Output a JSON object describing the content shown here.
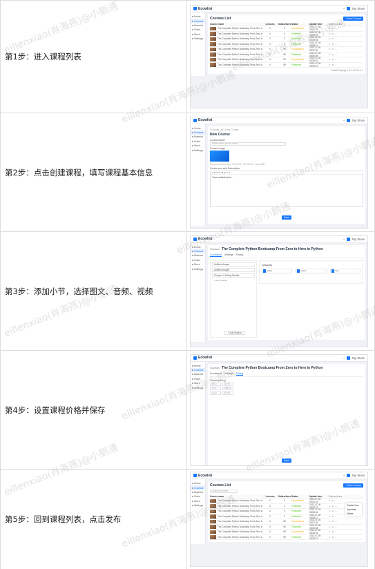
{
  "steps": [
    {
      "label": "第1步：进入课程列表"
    },
    {
      "label": "第2步：点击创建课程，填写课程基本信息"
    },
    {
      "label": "第3步：添加小节，选择图文、音频、视频"
    },
    {
      "label": "第4步：设置课程价格并保存"
    },
    {
      "label": "第5步：回到课程列表，点击发布"
    }
  ],
  "watermark": "eillenxiao(肖海燕)@小鹅通",
  "app": {
    "logo": "Ecowlist",
    "user": "My Store",
    "nav": [
      "Home",
      "Courses",
      "Material",
      "Order",
      "Store",
      "Settings"
    ]
  },
  "course_list": {
    "title": "Courses List",
    "new_button": "+ New Course",
    "search_placeholder": "Search by name",
    "columns": [
      "Course name",
      "Lessons",
      "Subscribers",
      "Status",
      "Update time",
      "Operation"
    ],
    "rows": [
      {
        "name": "The Complete Python Bootcamp From Zero to Hero in Python",
        "lessons": "0",
        "subs": "0",
        "status": "Unpublished",
        "time": "2023-07-05 09:00:23"
      },
      {
        "name": "The Complete Python Bootcamp From Zero to Hero in Python",
        "lessons": "0",
        "subs": "0",
        "status": "Published",
        "time": "2023-07-05 08:59:12"
      },
      {
        "name": "The Complete Python Bootcamp From Zero to Hero in Python",
        "lessons": "0",
        "subs": "0",
        "status": "Published",
        "time": "2023-07-05 08:58:45"
      },
      {
        "name": "The Complete Python Bootcamp From Zero to Hero in Python",
        "lessons": "0",
        "subs": "0",
        "status": "Published",
        "time": "2023-07-05 08:58:11"
      },
      {
        "name": "The Complete Python Bootcamp From Zero to Hero in Python",
        "lessons": "0",
        "subs": "99",
        "status": "Unpublished",
        "time": "2023-07-05 08:57:30"
      },
      {
        "name": "The Complete Python Bootcamp From Zero to Hero in Python",
        "lessons": "0",
        "subs": "99",
        "status": "Published",
        "time": "2023-07-05 08:56:58"
      },
      {
        "name": "The Complete Python Bootcamp From Zero to Hero in Python",
        "lessons": "0",
        "subs": "99",
        "status": "Unpublished",
        "time": "2023-07-05 08:56:02"
      },
      {
        "name": "The Complete Python Bootcamp From Zero to Hero in Python",
        "lessons": "0",
        "subs": "99",
        "status": "Published",
        "time": "2023-07-05 08:55:21"
      }
    ],
    "ops": "✎ ⧉ ⋯",
    "pager": "Total 8   10/page   1   2   3   4   5   Go to 1"
  },
  "new_course": {
    "crumb": "Courses List / New Course",
    "title": "New Course",
    "name_label": "Course Name",
    "name_placeholder": "Please enter course name",
    "image_label": "Course image",
    "image_hint": "Recommended size 750x422, JPG/PNG, max 2MB",
    "desc_label": "Course pre-sale Description",
    "toolbar": "H   B   I   U   ≡   ≔   ⊞   ↶   ↷",
    "body": "Your content here...",
    "save": "Save"
  },
  "course_edit": {
    "crumb": "Courses",
    "title": "The Complete Python Bootcamp From Zero to Hero in Python",
    "tabs": [
      "Curriculum",
      "Settings",
      "Pricing"
    ],
    "chapters": [
      "Untitled chapter",
      "Untitled chapter",
      "Chapter 1 Getting Started"
    ],
    "add_chapter": "+ Add Chapter",
    "add_section": "+ Add Section",
    "lessons_title": "Lessons",
    "types": [
      "Video",
      "Audio",
      "Text"
    ],
    "price_label": "Course pricing",
    "prices": [
      {
        "currency": "USD",
        "value": "$9.99"
      },
      {
        "currency": "CNY",
        "value": "¥68.00"
      },
      {
        "currency": "USD",
        "value": "$9.99"
      }
    ],
    "save": "Save"
  },
  "publish_menu": [
    "Publish Now",
    "Unpublish",
    "Delete"
  ]
}
